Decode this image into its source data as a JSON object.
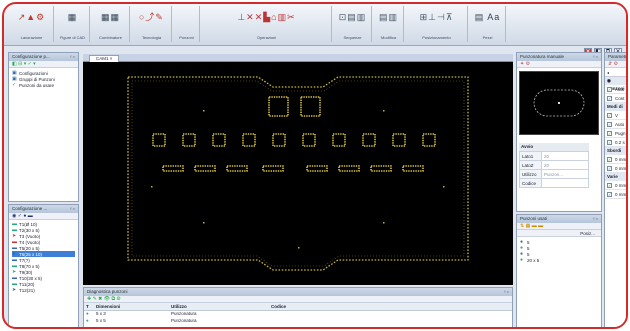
{
  "ribbon": {
    "groups": [
      {
        "label": "Lavorazione",
        "icons": "↗▲⚙",
        "color": "#c0392b"
      },
      {
        "label": "Figure di CAD",
        "icons": "▦",
        "color": "#345"
      },
      {
        "label": "Combinatore",
        "icons": "▦▦",
        "color": "#345"
      },
      {
        "label": "Tecnologia",
        "icons": "○⤴✎",
        "color": "#c0392b"
      },
      {
        "label": "Punzoni",
        "icons": "",
        "color": "#345"
      },
      {
        "label": "Operazioni",
        "icons": "⊥✕✕▙⌂▥✂",
        "color": "#b33"
      },
      {
        "label": "Sequenze",
        "icons": "⊡▤▥",
        "color": "#456"
      },
      {
        "label": "Modifica",
        "icons": "▤▥",
        "color": "#456"
      },
      {
        "label": "Posizionamento",
        "icons": "⊞⊥⊣⊼",
        "color": "#456"
      },
      {
        "label": "Pezzi",
        "icons": "▤ Aa",
        "color": "#345"
      }
    ]
  },
  "qat": [
    "✕",
    "◧",
    "⧉",
    "✕"
  ],
  "config_panel": {
    "title": "Configurazione p...",
    "toolbar": "◧ ⊟ ▾ ✓ ▾",
    "items": [
      "Configurazioni",
      "Gruppi di Punzoni",
      "Punzoni da usare"
    ]
  },
  "tools_panel": {
    "title": "Configurazione ...",
    "items": [
      "T1(Ø 10)",
      "T2(30 x 5)",
      "T3 (Vuoto)",
      "T4 (Vuoto)",
      "T5(20 x 5)",
      "T6(25 x 10)",
      "T7(?)",
      "T8(70 x 5)",
      "T9(30)",
      "T10(30 x 5)",
      "T11(20)",
      "T12(21)"
    ],
    "selected_index": 5
  },
  "cad": {
    "tab_label": "CAM1",
    "tab_close": "×"
  },
  "diagnostics": {
    "title": "Diagnostica punzoni",
    "toolbar": "✚ ✎ ✖ 👁 ⧉ ⚙",
    "columns": [
      "T",
      "Dimensioni",
      "Utilizzo",
      "Codice"
    ],
    "rows": [
      {
        "t": "●",
        "dim": "5 x 3",
        "use": "Punzonatura",
        "code": ""
      },
      {
        "t": "●",
        "dim": "5 x 5",
        "use": "Punzonatura",
        "code": ""
      }
    ]
  },
  "manual_panel": {
    "title": "Punzonatura manuale",
    "props_header": "Avvio",
    "props": [
      {
        "label": "Lato1",
        "value": "20"
      },
      {
        "label": "LatoZ",
        "value": "20"
      },
      {
        "label": "Utilizzo",
        "value": "Punzon..."
      },
      {
        "label": "Codice",
        "value": ""
      }
    ]
  },
  "used_panel": {
    "title": "Punzoni usati",
    "column": "Posiz...",
    "items": [
      "5",
      "5",
      "5",
      "20 x 5"
    ]
  },
  "params_panel": {
    "title": "Parametri di...",
    "section1": "Punzoni",
    "section2": "Modi di",
    "section3": "Sbordi",
    "section4": "Varie",
    "items": [
      "Auto",
      "Cont",
      "V",
      "Auto",
      "Pugn",
      "0.2 s",
      "0 mm",
      "0 mm",
      "0 mm",
      "0 mm"
    ]
  }
}
